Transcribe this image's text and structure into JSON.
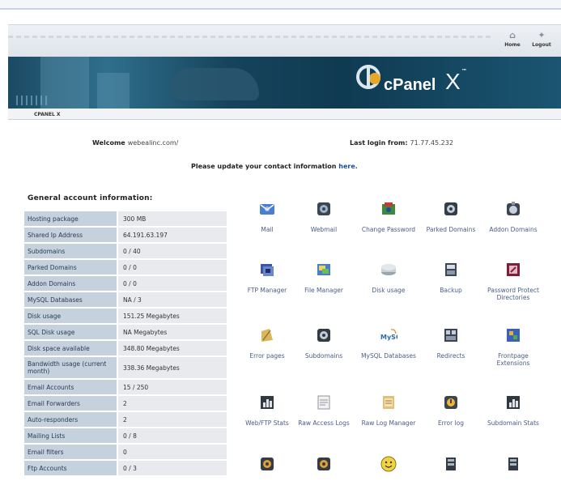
{
  "nav": {
    "home": "Home",
    "logout": "Logout"
  },
  "brand": {
    "name": "cPanel",
    "version": "X",
    "tm": "™"
  },
  "breadcrumb": "CPANEL X",
  "welcome": {
    "label": "Welcome",
    "domain": "webealinc.com/"
  },
  "last_login": {
    "label": "Last login from:",
    "ip": "71.77.45.232"
  },
  "notice": {
    "text": "Please update your contact information",
    "link": "here."
  },
  "info": {
    "title": "General account information:",
    "rows": [
      {
        "k": "Hosting package",
        "v": "300 MB"
      },
      {
        "k": "Shared Ip Address",
        "v": "64.191.63.197"
      },
      {
        "k": "Subdomains",
        "v": "0 / 40"
      },
      {
        "k": "Parked Domains",
        "v": "0 / 0"
      },
      {
        "k": "Addon Domains",
        "v": "0 / 0"
      },
      {
        "k": "MySQL Databases",
        "v": "NA / 3"
      },
      {
        "k": "Disk usage",
        "v": "151.25 Megabytes"
      },
      {
        "k": "SQL Disk usage",
        "v": "NA Megabytes"
      },
      {
        "k": "Disk space available",
        "v": "348.80 Megabytes"
      },
      {
        "k": "Bandwidth usage (current month)",
        "v": "338.36 Megabytes"
      },
      {
        "k": "Email Accounts",
        "v": "15 / 250"
      },
      {
        "k": "Email Forwarders",
        "v": "2"
      },
      {
        "k": "Auto-responders",
        "v": "2"
      },
      {
        "k": "Mailing Lists",
        "v": "0 / 8"
      },
      {
        "k": "Email filters",
        "v": "0"
      },
      {
        "k": "Ftp Accounts",
        "v": "0 / 3"
      }
    ]
  },
  "icons": [
    {
      "label": "Mail",
      "icon": "mail-icon"
    },
    {
      "label": "Webmail",
      "icon": "webmail-icon"
    },
    {
      "label": "Change Password",
      "icon": "change-password-icon"
    },
    {
      "label": "Parked Domains",
      "icon": "parked-domains-icon"
    },
    {
      "label": "Addon Domains",
      "icon": "addon-domains-icon"
    },
    {
      "label": "FTP Manager",
      "icon": "ftp-manager-icon"
    },
    {
      "label": "File Manager",
      "icon": "file-manager-icon"
    },
    {
      "label": "Disk usage",
      "icon": "disk-usage-icon"
    },
    {
      "label": "Backup",
      "icon": "backup-icon"
    },
    {
      "label": "Password Protect Directories",
      "icon": "password-protect-icon"
    },
    {
      "label": "Error pages",
      "icon": "error-pages-icon"
    },
    {
      "label": "Subdomains",
      "icon": "subdomains-icon"
    },
    {
      "label": "MySQL Databases",
      "icon": "mysql-icon"
    },
    {
      "label": "Redirects",
      "icon": "redirects-icon"
    },
    {
      "label": "Frontpage Extensions",
      "icon": "frontpage-icon"
    },
    {
      "label": "Web/FTP Stats",
      "icon": "web-ftp-stats-icon"
    },
    {
      "label": "Raw Access Logs",
      "icon": "raw-access-logs-icon"
    },
    {
      "label": "Raw Log Manager",
      "icon": "raw-log-manager-icon"
    },
    {
      "label": "Error log",
      "icon": "error-log-icon"
    },
    {
      "label": "Subdomain Stats",
      "icon": "subdomain-stats-icon"
    },
    {
      "label": "",
      "icon": "speaker-icon"
    },
    {
      "label": "",
      "icon": "speaker-icon"
    },
    {
      "label": "",
      "icon": "smiley-icon"
    },
    {
      "label": "",
      "icon": "server-icon"
    },
    {
      "label": "",
      "icon": "server-icon"
    }
  ],
  "colors": {
    "banner": "#1b4a63",
    "label_bg": "#c5d1dc",
    "value_bg": "#e8eaee",
    "link": "#1c4fa3"
  }
}
